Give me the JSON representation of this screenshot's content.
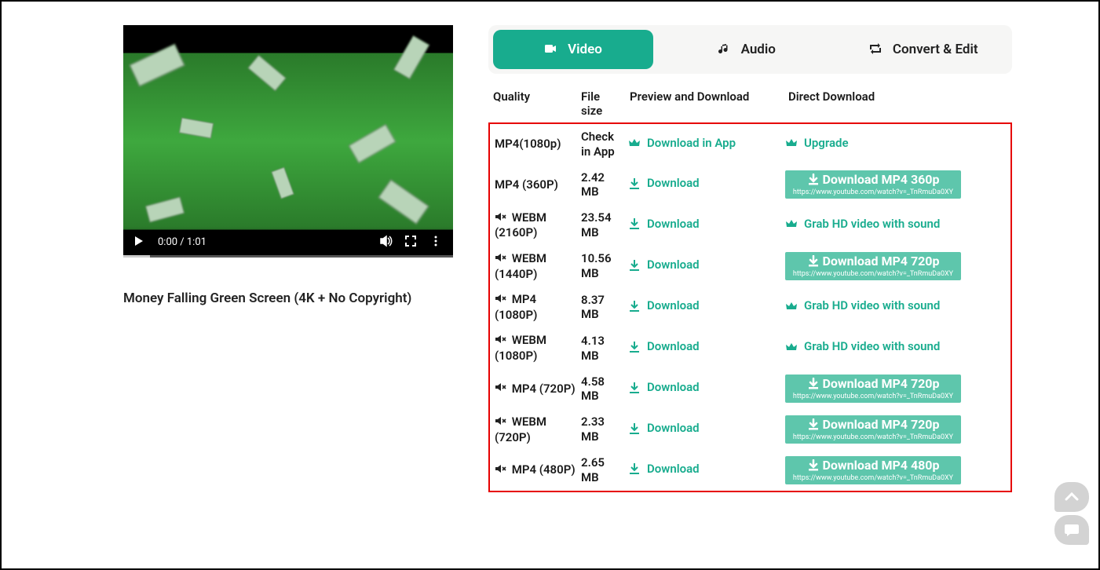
{
  "video": {
    "time": "0:00 / 1:01",
    "title": "Money Falling Green Screen (4K + No Copyright)"
  },
  "tabs": {
    "video": "Video",
    "audio": "Audio",
    "convert": "Convert & Edit"
  },
  "headers": {
    "quality": "Quality",
    "size": "File size",
    "preview": "Preview and Download",
    "direct": "Direct Download"
  },
  "links": {
    "download_in_app": "Download in App",
    "upgrade": "Upgrade",
    "download": "Download",
    "grab_hd": "Grab HD video with sound"
  },
  "btn_url": "https://www.youtube.com/watch?v=_TnRmuDa0XY",
  "rows": [
    {
      "quality": "MP4(1080p)",
      "muted": false,
      "size": "Check in App",
      "preview": "app",
      "direct": "upgrade"
    },
    {
      "quality": "MP4 (360P)",
      "muted": false,
      "size": "2.42 MB",
      "preview": "download",
      "direct": "btn",
      "btn": "Download MP4 360p"
    },
    {
      "quality": "WEBM (2160P)",
      "muted": true,
      "size": "23.54 MB",
      "preview": "download",
      "direct": "grab"
    },
    {
      "quality": "WEBM (1440P)",
      "muted": true,
      "size": "10.56 MB",
      "preview": "download",
      "direct": "btn",
      "btn": "Download MP4 720p"
    },
    {
      "quality": "MP4 (1080P)",
      "muted": true,
      "size": "8.37 MB",
      "preview": "download",
      "direct": "grab"
    },
    {
      "quality": "WEBM (1080P)",
      "muted": true,
      "size": "4.13 MB",
      "preview": "download",
      "direct": "grab"
    },
    {
      "quality": "MP4 (720P)",
      "muted": true,
      "size": "4.58 MB",
      "preview": "download",
      "direct": "btn",
      "btn": "Download MP4 720p"
    },
    {
      "quality": "WEBM (720P)",
      "muted": true,
      "size": "2.33 MB",
      "preview": "download",
      "direct": "btn",
      "btn": "Download MP4 720p"
    },
    {
      "quality": "MP4 (480P)",
      "muted": true,
      "size": "2.65 MB",
      "preview": "download",
      "direct": "btn",
      "btn": "Download MP4 480p"
    }
  ]
}
